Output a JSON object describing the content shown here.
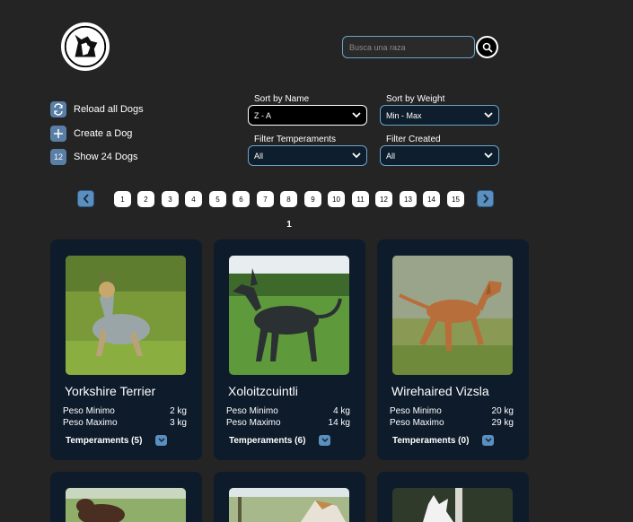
{
  "header": {
    "logo_icon": "dog-head-logo-icon",
    "search": {
      "placeholder": "Busca una raza",
      "value": ""
    },
    "search_icon": "search-icon"
  },
  "actions": [
    {
      "label": "Reload all Dogs",
      "icon": "reload-icon",
      "icon_text": ""
    },
    {
      "label": "Create a Dog",
      "icon": "plus-icon",
      "icon_text": ""
    },
    {
      "label": "Show 24 Dogs",
      "icon": "count-icon",
      "icon_text": "12"
    }
  ],
  "filters": {
    "sort_name": {
      "label": "Sort by Name",
      "value": "Z - A"
    },
    "sort_weight": {
      "label": "Sort by Weight",
      "value": "Min - Max"
    },
    "temperaments": {
      "label": "Filter Temperaments",
      "value": "All"
    },
    "created": {
      "label": "Filter Created",
      "value": "All"
    }
  },
  "pagination": {
    "pages": [
      "1",
      "2",
      "3",
      "4",
      "5",
      "6",
      "7",
      "8",
      "9",
      "10",
      "11",
      "12",
      "13",
      "14",
      "15"
    ],
    "current": "1"
  },
  "labels": {
    "peso_min": "Peso Minimo",
    "peso_max": "Peso Maximo"
  },
  "cards": [
    {
      "name": "Yorkshire Terrier",
      "min": "2 kg",
      "max": "3 kg",
      "temperaments": "Temperaments (5)"
    },
    {
      "name": "Xoloitzcuintli",
      "min": "4 kg",
      "max": "14 kg",
      "temperaments": "Temperaments (6)"
    },
    {
      "name": "Wirehaired Vizsla",
      "min": "20 kg",
      "max": "29 kg",
      "temperaments": "Temperaments (0)"
    }
  ],
  "colors": {
    "background": "#242424",
    "card": "#0d1b2b",
    "accent": "#5a8fc0",
    "border": "#6aa3c8"
  }
}
